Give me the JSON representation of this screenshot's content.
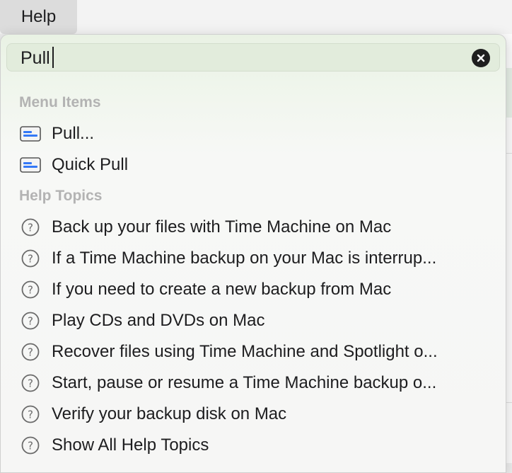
{
  "menubar": {
    "help_label": "Help"
  },
  "search": {
    "value": "Pull"
  },
  "sections": {
    "menu_items": "Menu Items",
    "help_topics": "Help Topics"
  },
  "menu_items": [
    {
      "label": "Pull..."
    },
    {
      "label": "Quick Pull"
    }
  ],
  "help_topics": [
    {
      "label": "Back up your files with Time Machine on Mac"
    },
    {
      "label": "If a Time Machine backup on your Mac is interrup..."
    },
    {
      "label": "If you need to create a new backup from Mac"
    },
    {
      "label": "Play CDs and DVDs on Mac"
    },
    {
      "label": "Recover files using Time Machine and Spotlight o..."
    },
    {
      "label": "Start, pause or resume a Time Machine backup o..."
    },
    {
      "label": "Verify your backup disk on Mac"
    },
    {
      "label": "Show All Help Topics"
    }
  ],
  "colors": {
    "accent": "#3478f6",
    "section_header": "#b3b3b3"
  }
}
